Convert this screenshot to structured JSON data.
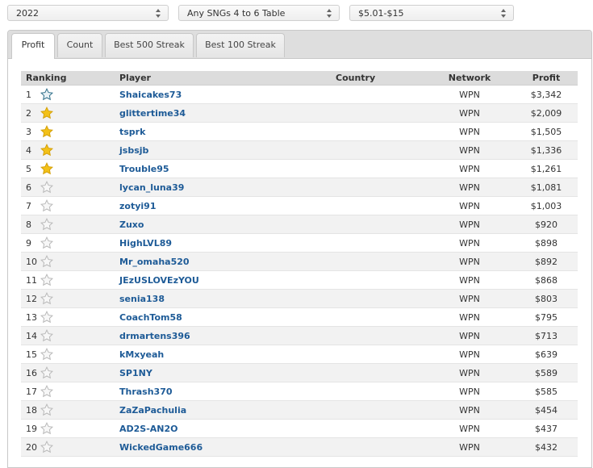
{
  "filters": {
    "year": "2022",
    "game_type": "Any SNGs 4 to 6 Table",
    "stakes": "$5.01-$15"
  },
  "tabs": [
    {
      "label": "Profit",
      "active": true
    },
    {
      "label": "Count",
      "active": false
    },
    {
      "label": "Best 500 Streak",
      "active": false
    },
    {
      "label": "Best 100 Streak",
      "active": false
    }
  ],
  "table": {
    "headers": {
      "ranking": "Ranking",
      "player": "Player",
      "country": "Country",
      "network": "Network",
      "profit": "Profit"
    },
    "rows": [
      {
        "rank": "1",
        "player": "Shaicakes73",
        "country": "",
        "network": "WPN",
        "profit": "$3,342",
        "star": "star-outline-icon-blue"
      },
      {
        "rank": "2",
        "player": "glittertime34",
        "country": "",
        "network": "WPN",
        "profit": "$2,009",
        "star": "star-gold-icon"
      },
      {
        "rank": "3",
        "player": "tsprk",
        "country": "",
        "network": "WPN",
        "profit": "$1,505",
        "star": "star-gold-icon"
      },
      {
        "rank": "4",
        "player": "jsbsjb",
        "country": "",
        "network": "WPN",
        "profit": "$1,336",
        "star": "star-gold-icon"
      },
      {
        "rank": "5",
        "player": "Trouble95",
        "country": "",
        "network": "WPN",
        "profit": "$1,261",
        "star": "star-gold-icon"
      },
      {
        "rank": "6",
        "player": "lycan_luna39",
        "country": "",
        "network": "WPN",
        "profit": "$1,081",
        "star": "star-gray-icon"
      },
      {
        "rank": "7",
        "player": "zotyi91",
        "country": "",
        "network": "WPN",
        "profit": "$1,003",
        "star": "star-gray-icon"
      },
      {
        "rank": "8",
        "player": "Zuxo",
        "country": "",
        "network": "WPN",
        "profit": "$920",
        "star": "star-gray-icon"
      },
      {
        "rank": "9",
        "player": "HighLVL89",
        "country": "",
        "network": "WPN",
        "profit": "$898",
        "star": "star-gray-icon"
      },
      {
        "rank": "10",
        "player": "Mr_omaha520",
        "country": "",
        "network": "WPN",
        "profit": "$892",
        "star": "star-gray-icon"
      },
      {
        "rank": "11",
        "player": "JEzUSLOVEzYOU",
        "country": "",
        "network": "WPN",
        "profit": "$868",
        "star": "star-gray-icon"
      },
      {
        "rank": "12",
        "player": "senia138",
        "country": "",
        "network": "WPN",
        "profit": "$803",
        "star": "star-gray-icon"
      },
      {
        "rank": "13",
        "player": "CoachTom58",
        "country": "",
        "network": "WPN",
        "profit": "$795",
        "star": "star-gray-icon"
      },
      {
        "rank": "14",
        "player": "drmartens396",
        "country": "",
        "network": "WPN",
        "profit": "$713",
        "star": "star-gray-icon"
      },
      {
        "rank": "15",
        "player": "kMxyeah",
        "country": "",
        "network": "WPN",
        "profit": "$639",
        "star": "star-gray-icon"
      },
      {
        "rank": "16",
        "player": "SP1NY",
        "country": "",
        "network": "WPN",
        "profit": "$589",
        "star": "star-gray-icon"
      },
      {
        "rank": "17",
        "player": "Thrash370",
        "country": "",
        "network": "WPN",
        "profit": "$585",
        "star": "star-gray-icon"
      },
      {
        "rank": "18",
        "player": "ZaZaPachulia",
        "country": "",
        "network": "WPN",
        "profit": "$454",
        "star": "star-gray-icon"
      },
      {
        "rank": "19",
        "player": "AD2S-AN2O",
        "country": "",
        "network": "WPN",
        "profit": "$437",
        "star": "star-gray-icon"
      },
      {
        "rank": "20",
        "player": "WickedGame666",
        "country": "",
        "network": "WPN",
        "profit": "$432",
        "star": "star-gray-icon"
      }
    ]
  },
  "colors": {
    "link": "#1e5b97",
    "gold_star": "#f3c118",
    "gray_star": "#b9b9b9",
    "blue_star": "#2f6f8a"
  }
}
